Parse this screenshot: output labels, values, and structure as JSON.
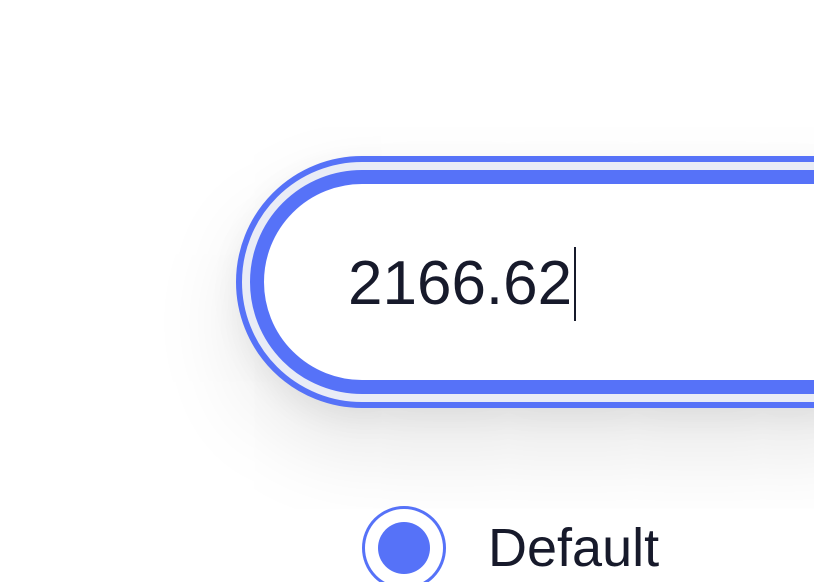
{
  "input": {
    "value": "2166.62"
  },
  "radio": {
    "label": "Default",
    "selected": true
  },
  "colors": {
    "accent": "#5672f8",
    "text": "#171a2b",
    "background": "#ffffff"
  }
}
